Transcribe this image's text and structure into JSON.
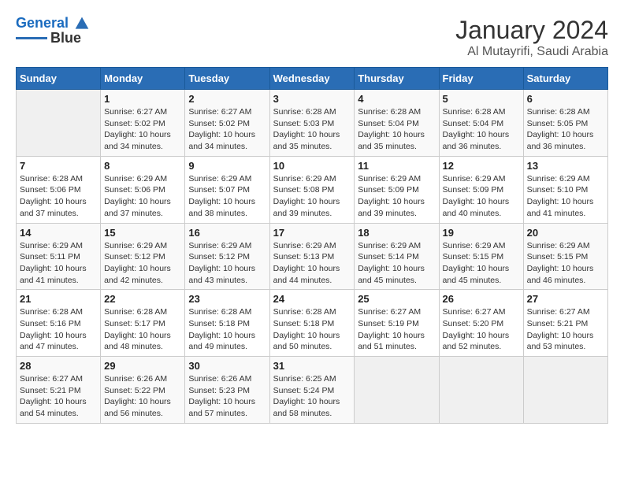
{
  "header": {
    "logo_line1": "General",
    "logo_line2": "Blue",
    "month": "January 2024",
    "location": "Al Mutayrifi, Saudi Arabia"
  },
  "weekdays": [
    "Sunday",
    "Monday",
    "Tuesday",
    "Wednesday",
    "Thursday",
    "Friday",
    "Saturday"
  ],
  "weeks": [
    [
      {
        "day": "",
        "info": ""
      },
      {
        "day": "1",
        "info": "Sunrise: 6:27 AM\nSunset: 5:02 PM\nDaylight: 10 hours\nand 34 minutes."
      },
      {
        "day": "2",
        "info": "Sunrise: 6:27 AM\nSunset: 5:02 PM\nDaylight: 10 hours\nand 34 minutes."
      },
      {
        "day": "3",
        "info": "Sunrise: 6:28 AM\nSunset: 5:03 PM\nDaylight: 10 hours\nand 35 minutes."
      },
      {
        "day": "4",
        "info": "Sunrise: 6:28 AM\nSunset: 5:04 PM\nDaylight: 10 hours\nand 35 minutes."
      },
      {
        "day": "5",
        "info": "Sunrise: 6:28 AM\nSunset: 5:04 PM\nDaylight: 10 hours\nand 36 minutes."
      },
      {
        "day": "6",
        "info": "Sunrise: 6:28 AM\nSunset: 5:05 PM\nDaylight: 10 hours\nand 36 minutes."
      }
    ],
    [
      {
        "day": "7",
        "info": "Sunrise: 6:28 AM\nSunset: 5:06 PM\nDaylight: 10 hours\nand 37 minutes."
      },
      {
        "day": "8",
        "info": "Sunrise: 6:29 AM\nSunset: 5:06 PM\nDaylight: 10 hours\nand 37 minutes."
      },
      {
        "day": "9",
        "info": "Sunrise: 6:29 AM\nSunset: 5:07 PM\nDaylight: 10 hours\nand 38 minutes."
      },
      {
        "day": "10",
        "info": "Sunrise: 6:29 AM\nSunset: 5:08 PM\nDaylight: 10 hours\nand 39 minutes."
      },
      {
        "day": "11",
        "info": "Sunrise: 6:29 AM\nSunset: 5:09 PM\nDaylight: 10 hours\nand 39 minutes."
      },
      {
        "day": "12",
        "info": "Sunrise: 6:29 AM\nSunset: 5:09 PM\nDaylight: 10 hours\nand 40 minutes."
      },
      {
        "day": "13",
        "info": "Sunrise: 6:29 AM\nSunset: 5:10 PM\nDaylight: 10 hours\nand 41 minutes."
      }
    ],
    [
      {
        "day": "14",
        "info": "Sunrise: 6:29 AM\nSunset: 5:11 PM\nDaylight: 10 hours\nand 41 minutes."
      },
      {
        "day": "15",
        "info": "Sunrise: 6:29 AM\nSunset: 5:12 PM\nDaylight: 10 hours\nand 42 minutes."
      },
      {
        "day": "16",
        "info": "Sunrise: 6:29 AM\nSunset: 5:12 PM\nDaylight: 10 hours\nand 43 minutes."
      },
      {
        "day": "17",
        "info": "Sunrise: 6:29 AM\nSunset: 5:13 PM\nDaylight: 10 hours\nand 44 minutes."
      },
      {
        "day": "18",
        "info": "Sunrise: 6:29 AM\nSunset: 5:14 PM\nDaylight: 10 hours\nand 45 minutes."
      },
      {
        "day": "19",
        "info": "Sunrise: 6:29 AM\nSunset: 5:15 PM\nDaylight: 10 hours\nand 45 minutes."
      },
      {
        "day": "20",
        "info": "Sunrise: 6:29 AM\nSunset: 5:15 PM\nDaylight: 10 hours\nand 46 minutes."
      }
    ],
    [
      {
        "day": "21",
        "info": "Sunrise: 6:28 AM\nSunset: 5:16 PM\nDaylight: 10 hours\nand 47 minutes."
      },
      {
        "day": "22",
        "info": "Sunrise: 6:28 AM\nSunset: 5:17 PM\nDaylight: 10 hours\nand 48 minutes."
      },
      {
        "day": "23",
        "info": "Sunrise: 6:28 AM\nSunset: 5:18 PM\nDaylight: 10 hours\nand 49 minutes."
      },
      {
        "day": "24",
        "info": "Sunrise: 6:28 AM\nSunset: 5:18 PM\nDaylight: 10 hours\nand 50 minutes."
      },
      {
        "day": "25",
        "info": "Sunrise: 6:27 AM\nSunset: 5:19 PM\nDaylight: 10 hours\nand 51 minutes."
      },
      {
        "day": "26",
        "info": "Sunrise: 6:27 AM\nSunset: 5:20 PM\nDaylight: 10 hours\nand 52 minutes."
      },
      {
        "day": "27",
        "info": "Sunrise: 6:27 AM\nSunset: 5:21 PM\nDaylight: 10 hours\nand 53 minutes."
      }
    ],
    [
      {
        "day": "28",
        "info": "Sunrise: 6:27 AM\nSunset: 5:21 PM\nDaylight: 10 hours\nand 54 minutes."
      },
      {
        "day": "29",
        "info": "Sunrise: 6:26 AM\nSunset: 5:22 PM\nDaylight: 10 hours\nand 56 minutes."
      },
      {
        "day": "30",
        "info": "Sunrise: 6:26 AM\nSunset: 5:23 PM\nDaylight: 10 hours\nand 57 minutes."
      },
      {
        "day": "31",
        "info": "Sunrise: 6:25 AM\nSunset: 5:24 PM\nDaylight: 10 hours\nand 58 minutes."
      },
      {
        "day": "",
        "info": ""
      },
      {
        "day": "",
        "info": ""
      },
      {
        "day": "",
        "info": ""
      }
    ]
  ]
}
